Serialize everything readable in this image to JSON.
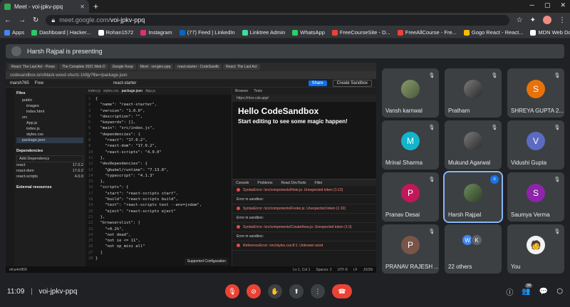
{
  "browser": {
    "tab_title": "Meet - voi-jpkv-ppq",
    "url_host": "meet.google.com/",
    "url_path": "voi-jpkv-ppq",
    "new_tab": "+",
    "win_minimize": "─",
    "win_restore": "▢",
    "win_close": "✕",
    "bookmarks": [
      {
        "label": "Apps",
        "color": "#4285f4"
      },
      {
        "label": "Dashboard | Hacker...",
        "color": "#2ec866"
      },
      {
        "label": "Rohan1572",
        "color": "#ffffff"
      },
      {
        "label": "Instagram",
        "color": "#e1306c"
      },
      {
        "label": "(77) Feed | LinkedIn",
        "color": "#0a66c2"
      },
      {
        "label": "Linktree Admin",
        "color": "#39e09b"
      },
      {
        "label": "WhatsApp",
        "color": "#25d366"
      },
      {
        "label": "FreeCourseSite - D...",
        "color": "#ea4335"
      },
      {
        "label": "FreeAllCourse - Fre...",
        "color": "#ea4335"
      },
      {
        "label": "Gogo React - React...",
        "color": "#fbbc04"
      },
      {
        "label": "MDN Web Docs",
        "color": "#ffffff"
      }
    ],
    "more_bookmarks": "»",
    "reading_list": "Reading list"
  },
  "presenting_banner": "Harsh Rajpal is presenting",
  "shared_screen": {
    "tabs": [
      "React: The Last Act - Prese",
      "The Complete 2021 Web D",
      "Google Keep",
      "Meet - voi-jpkv-ppq",
      "react-starter - CodeSandb",
      "React: The Last Act"
    ],
    "address": "codesandbox.io/s/black-wood-shurtz-1k9jy?file=/package.json",
    "user": "marsh765",
    "user_badge": "Free",
    "project": "react-starter",
    "share_btn": "Share",
    "create_btn": "Create Sandbox",
    "files_header": "Files",
    "files": [
      "public",
      "images",
      "index.html",
      "src",
      "App.js",
      "index.js",
      "styles.css",
      "package.json"
    ],
    "deps_header": "Dependencies",
    "add_dep": "Add Dependency",
    "deps": [
      {
        "name": "react",
        "ver": "17.0.2"
      },
      {
        "name": "react-dom",
        "ver": "17.0.2"
      },
      {
        "name": "react-scripts",
        "ver": "4.0.0"
      }
    ],
    "external": "External resources",
    "editor_tabs": [
      "index.js",
      "styles.css",
      "package.json",
      "App.js"
    ],
    "code_lines": [
      "{",
      "  \"name\": \"react-starter\",",
      "  \"version\": \"1.0.0\",",
      "  \"description\": \"\",",
      "  \"keywords\": [],",
      "  \"main\": \"src/index.js\",",
      "  \"dependencies\": {",
      "    \"react\": \"17.0.2\",",
      "    \"react-dom\": \"17.0.2\",",
      "    \"react-scripts\": \"4.0.0\"",
      "  },",
      "  \"devDependencies\": {",
      "    \"@babel/runtime\": \"7.13.8\",",
      "    \"typescript\": \"4.1.3\"",
      "  },",
      "  \"scripts\": {",
      "    \"start\": \"react-scripts start\",",
      "    \"build\": \"react-scripts build\",",
      "    \"test\": \"react-scripts test --env=jsdom\",",
      "    \"eject\": \"react-scripts eject\"",
      "  },",
      "  \"browserslist\": [",
      "    \">0.2%\",",
      "    \"not dead\",",
      "    \"not ie <= 11\",",
      "    \"not op_mini all\"",
      "  ]",
      "}"
    ],
    "supported": "Supported Configuration",
    "preview_tabs": [
      "Browser",
      "Tests"
    ],
    "preview_url": "https://rlnrz.csb.app/",
    "preview_title": "Hello CodeSandbox",
    "preview_sub": "Start editing to see some magic happen!",
    "console_tabs": [
      "Console",
      "Problems",
      "React DevTools",
      "Filter"
    ],
    "console_rows": [
      {
        "text": "SyntaxError: /src/components/Note.js: Unexpected token (1:13)",
        "err": true
      },
      {
        "text": "Error in sandbox:",
        "err": false
      },
      {
        "text": "SyntaxError: /src/components/Footer.js: Unexpected token (1:10)",
        "err": true
      },
      {
        "text": "Error in sandbox:",
        "err": false
      },
      {
        "text": "SyntaxError: /src/components/CreateArea.js: Unexpected token (1:3)",
        "err": true
      },
      {
        "text": "Error in sandbox:",
        "err": false
      },
      {
        "text": "ReferenceError: /src/styles.css:8:1: Unknown word",
        "err": true
      }
    ],
    "status_left": "efca4e9f09",
    "status_right": [
      "Ln 1, Col 1",
      "Spaces: 2",
      "UTF-8",
      "LF",
      "JSON"
    ]
  },
  "tiles": [
    {
      "name": "Vansh karnwal",
      "kind": "photo",
      "initial": "",
      "color": "",
      "muted": true
    },
    {
      "name": "Pratham",
      "kind": "photo2",
      "initial": "",
      "color": "",
      "muted": true
    },
    {
      "name": "SHREYA GUPTA 2...",
      "kind": "letter",
      "initial": "S",
      "color": "#e8710a",
      "muted": true
    },
    {
      "name": "Mrinal Sharma",
      "kind": "letter",
      "initial": "M",
      "color": "#12b5cb",
      "muted": true
    },
    {
      "name": "Mukund Agarwal",
      "kind": "photo2",
      "initial": "",
      "color": "",
      "muted": true
    },
    {
      "name": "Vidushi Gupta",
      "kind": "letter",
      "initial": "V",
      "color": "#5c6bc0",
      "muted": true
    },
    {
      "name": "Pranav Desai",
      "kind": "letter",
      "initial": "P",
      "color": "#c2185b",
      "muted": true
    },
    {
      "name": "Harsh Rajpal",
      "kind": "photo3",
      "initial": "",
      "color": "",
      "muted": false
    },
    {
      "name": "Saumya Verma",
      "kind": "letter",
      "initial": "S",
      "color": "#8e24aa",
      "muted": true
    },
    {
      "name": "PRANAV RAJESH ...",
      "kind": "letter",
      "initial": "P",
      "color": "#795548",
      "muted": true
    },
    {
      "name": "22 others",
      "kind": "others",
      "initial": "",
      "color": "",
      "muted": false
    },
    {
      "name": "You",
      "kind": "cartoon",
      "initial": "",
      "color": "",
      "muted": true
    }
  ],
  "others_initials": [
    {
      "ch": "W",
      "color": "#4285f4"
    },
    {
      "ch": "K",
      "color": "#5f6368"
    }
  ],
  "bottom": {
    "time": "11:09",
    "separator": "|",
    "code": "voi-jpkv-ppq",
    "participants_count": "34"
  },
  "icons": {
    "back": "←",
    "forward": "→",
    "reload": "↻",
    "star": "☆",
    "ext": "✦",
    "menu": "⋮",
    "muted": "🎙︎",
    "talk": "≡",
    "mic_off": "🎙︎",
    "cam_off": "⊘",
    "hand": "✋",
    "present": "⬆",
    "more": "⋮",
    "end_call": "☎",
    "info": "ⓘ",
    "people": "👥",
    "chat": "💬",
    "activities": "⬡"
  }
}
